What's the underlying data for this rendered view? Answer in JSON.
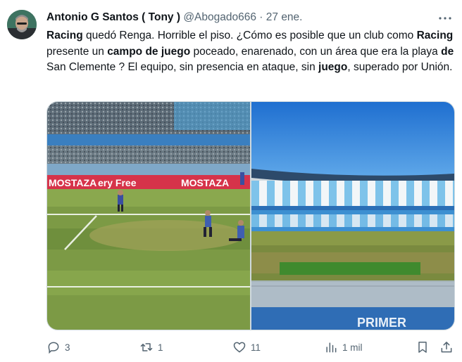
{
  "tweet": {
    "author_name": "Antonio G Santos ( Tony )",
    "handle": "@Abogado666",
    "separator": "·",
    "date": "27 ene.",
    "text_parts": [
      {
        "t": "Racing",
        "b": true
      },
      {
        "t": " quedó Renga. Horrible el piso. ¿Cómo es posible que un club como ",
        "b": false
      },
      {
        "t": "Racing",
        "b": true
      },
      {
        "t": " presente un ",
        "b": false
      },
      {
        "t": "campo de juego",
        "b": true
      },
      {
        "t": " poceado, enarenado, con un área que era la playa ",
        "b": false
      },
      {
        "t": "de",
        "b": true
      },
      {
        "t": " San Clemente ? El equipo, sin presencia en ataque, sin ",
        "b": false
      },
      {
        "t": "juego",
        "b": true
      },
      {
        "t": ", superado por Unión.",
        "b": false
      }
    ],
    "media": {
      "left_photo": {
        "description_icon": "stadium-pitch-photo",
        "board_texts": [
          "MOSTAZA",
          "ery Free",
          "MOSTAZA"
        ]
      },
      "right_photo": {
        "description_icon": "stadium-stands-photo",
        "board_text": "PRIMER"
      }
    },
    "actions": {
      "reply_count": "3",
      "retweet_count": "1",
      "like_count": "11",
      "views_count": "1 mil"
    }
  },
  "colors": {
    "text_primary": "#0f1419",
    "text_secondary": "#536471",
    "border": "#cfd9de",
    "sky": "#2f7fd6",
    "stand_light_blue": "#7ec3ea",
    "ad_board_red": "#d6334a"
  },
  "icons": [
    "more-icon",
    "reply-icon",
    "retweet-icon",
    "like-icon",
    "views-icon",
    "bookmark-icon",
    "share-icon"
  ]
}
